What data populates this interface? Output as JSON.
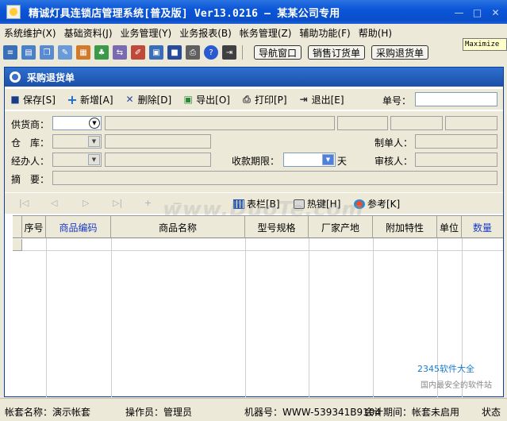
{
  "titlebar": {
    "title": "精诚灯具连锁店管理系统[普及版] Ver13.0216 — 某某公司专用",
    "minimize_glyph": "—",
    "maximize_glyph": "□",
    "close_glyph": "✕"
  },
  "menu": {
    "items": [
      "系统维护(X)",
      "基础资料(J)",
      "业务管理(Y)",
      "业务报表(B)",
      "帐务管理(Z)",
      "辅助功能(F)",
      "帮助(H)"
    ]
  },
  "maximize_tag": "Maximize",
  "toolbar": {
    "icons": [
      {
        "name": "list-icon",
        "color": "#3a6fb8"
      },
      {
        "name": "card-icon",
        "color": "#4a80c8"
      },
      {
        "name": "windows-icon",
        "color": "#5a8ad0"
      },
      {
        "name": "note-icon",
        "color": "#6a9ad8"
      },
      {
        "name": "document-icon",
        "color": "#d07a2a"
      },
      {
        "name": "users-icon",
        "color": "#3a9a4a"
      },
      {
        "name": "transfer-icon",
        "color": "#7a6ab0"
      },
      {
        "name": "edit-icon",
        "color": "#c04a3a"
      },
      {
        "name": "image-icon",
        "color": "#3a6fb8"
      },
      {
        "name": "save-icon",
        "color": "#2a4a9a"
      },
      {
        "name": "print-icon",
        "color": "#606060"
      },
      {
        "name": "help-icon",
        "color": "#2a5ad0"
      },
      {
        "name": "exit-icon",
        "color": "#404040"
      }
    ],
    "buttons": [
      "导航窗口",
      "销售订货单",
      "采购退货单"
    ]
  },
  "child": {
    "title": "采购退货单",
    "commands": [
      {
        "name": "save",
        "label": "保存[S]",
        "icon": "■",
        "color": "#1a3a8a"
      },
      {
        "name": "add",
        "label": "新增[A]",
        "icon": "+",
        "color": "#1a6ad0"
      },
      {
        "name": "delete",
        "label": "删除[D]",
        "icon": "✕",
        "color": "#2a4a9a"
      },
      {
        "name": "export",
        "label": "导出[O]",
        "icon": "▣",
        "color": "#2a8a3a"
      },
      {
        "name": "print",
        "label": "打印[P]",
        "icon": "⎙",
        "color": "#404040"
      },
      {
        "name": "exit",
        "label": "退出[E]",
        "icon": "⇥",
        "color": "#2a2a2a"
      }
    ],
    "doc_no_label": "单号："
  },
  "form": {
    "supplier_label": "供货商：",
    "warehouse_label": "仓　库：",
    "handler_label": "经办人：",
    "summary_label": "摘　要：",
    "payment_term_label": "收款期限：",
    "payment_term_unit": "天",
    "maker_label": "制单人：",
    "reviewer_label": "审核人："
  },
  "navbar": {
    "arrows": [
      "|◁",
      "◁",
      "▷",
      "▷|",
      "+",
      "—"
    ],
    "columns_label": "表栏[B]",
    "hotkeys_label": "热键[H]",
    "reference_label": "参考[K]"
  },
  "grid": {
    "columns": [
      {
        "label": "序号",
        "blue": false
      },
      {
        "label": "商品编码",
        "blue": true
      },
      {
        "label": "商品名称",
        "blue": false
      },
      {
        "label": "型号规格",
        "blue": false
      },
      {
        "label": "厂家产地",
        "blue": false
      },
      {
        "label": "附加特性",
        "blue": false
      },
      {
        "label": "单位",
        "blue": false
      },
      {
        "label": "数量",
        "blue": true
      }
    ]
  },
  "watermark": "www.DuoTe.com",
  "corner_logo": "2345软件大全",
  "corner_logo2": "国内最安全的软件站",
  "statusbar": {
    "account": "帐套名称：演示帐套",
    "operator": "操作员：管理员",
    "machine": "机器号：WWW-539341B9104",
    "period": "会计期间：帐套未启用",
    "state": "状态"
  }
}
